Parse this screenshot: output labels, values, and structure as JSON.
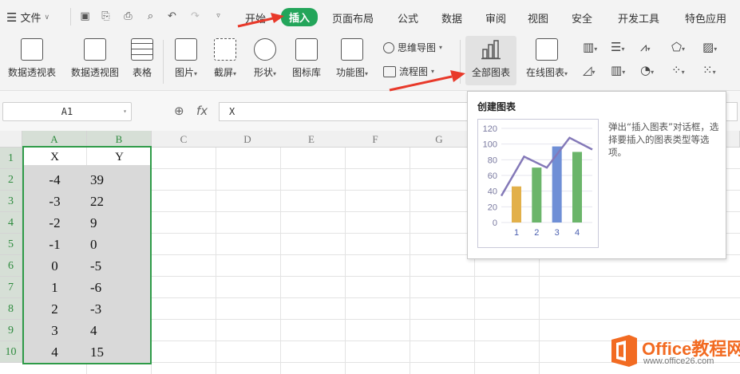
{
  "menu": {
    "file_label": "文件",
    "tabs": [
      "开始",
      "插入",
      "页面布局",
      "公式",
      "数据",
      "审阅",
      "视图",
      "安全",
      "开发工具",
      "特色应用"
    ],
    "active_tab": "插入"
  },
  "ribbon": {
    "big_buttons": [
      {
        "label": "数据透视表",
        "icon": "pivot-table-icon"
      },
      {
        "label": "数据透视图",
        "icon": "pivot-chart-icon"
      },
      {
        "label": "表格",
        "icon": "table-icon"
      },
      {
        "label": "图片",
        "icon": "picture-icon",
        "dropdown": true
      },
      {
        "label": "截屏",
        "icon": "screenshot-icon",
        "dropdown": true
      },
      {
        "label": "形状",
        "icon": "shape-icon",
        "dropdown": true
      },
      {
        "label": "图标库",
        "icon": "icon-library-icon"
      },
      {
        "label": "功能图",
        "icon": "function-chart-icon",
        "dropdown": true
      },
      {
        "label": "全部图表",
        "icon": "all-charts-icon"
      },
      {
        "label": "在线图表",
        "icon": "online-chart-icon",
        "dropdown": true
      }
    ],
    "small_buttons": [
      {
        "label": "思维导图",
        "icon": "mindmap-icon"
      },
      {
        "label": "流程图",
        "icon": "flowchart-icon"
      }
    ],
    "chart_type_icons": [
      "column-chart-icon",
      "bar-chart-icon",
      "line-chart-icon",
      "radar-chart-icon",
      "stock-chart-icon",
      "area-chart-icon",
      "combo-chart-icon",
      "pie-chart-icon",
      "scatter-chart-icon",
      "sparkline-icon"
    ]
  },
  "formula_bar": {
    "name_box": "A1",
    "fx_symbol": "fx",
    "value": "X"
  },
  "sheet": {
    "columns": [
      "A",
      "B",
      "C",
      "D",
      "E",
      "F",
      "G"
    ],
    "rows": [
      "1",
      "2",
      "3",
      "4",
      "5",
      "6",
      "7",
      "8",
      "9",
      "10"
    ],
    "cells": [
      [
        "X",
        "Y"
      ],
      [
        "-4",
        "39"
      ],
      [
        "-3",
        "22"
      ],
      [
        "-2",
        "9"
      ],
      [
        "-1",
        "0"
      ],
      [
        "0",
        "-5"
      ],
      [
        "1",
        "-6"
      ],
      [
        "2",
        "-3"
      ],
      [
        "3",
        "4"
      ],
      [
        "4",
        "15"
      ]
    ]
  },
  "tooltip": {
    "title": "创建图表",
    "description": "弹出“插入图表”对话框，选择要插入的图表类型等选项。"
  },
  "chart_data": {
    "type": "bar",
    "categories": [
      "1",
      "2",
      "3",
      "4"
    ],
    "values": [
      46,
      70,
      97,
      90
    ],
    "line_values": [
      34,
      84,
      70,
      108,
      93
    ],
    "ylim": [
      0,
      120
    ],
    "yticks": [
      "0",
      "20",
      "40",
      "60",
      "80",
      "100",
      "120"
    ],
    "bar_colors": [
      "#e2b04a",
      "#6bb56a",
      "#6f8fd6",
      "#6bb56a"
    ],
    "line_color": "#8479b8"
  },
  "watermark": {
    "brand": "Office教程网",
    "url": "www.office26.com"
  },
  "colors": {
    "accent_green": "#23a55a",
    "selection_green": "#2e9b48",
    "arrow_red": "#e8392a"
  }
}
